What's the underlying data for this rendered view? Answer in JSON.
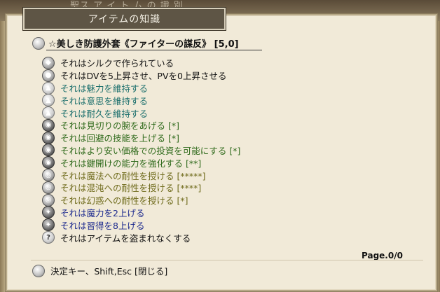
{
  "window": {
    "behind_title": "聖ス ア イ ト ム の 識 別",
    "title": "アイテムの知識"
  },
  "item": {
    "name": "☆美しき防護外套《ファイターの謀反》 [5,0]"
  },
  "properties": [
    {
      "text": "それはシルクで作られている",
      "color": "black",
      "icon": "gray-diamond-icon"
    },
    {
      "text": "それはDVを5上昇させ、PVを0上昇させる",
      "color": "black",
      "icon": "gray-shield-icon"
    },
    {
      "text": "それは魅力を維持する",
      "color": "teal",
      "icon": "light-body-icon"
    },
    {
      "text": "それは意思を維持する",
      "color": "teal",
      "icon": "light-body-icon"
    },
    {
      "text": "それは耐久を維持する",
      "color": "teal",
      "icon": "light-body-icon"
    },
    {
      "text": "それは見切りの腕をあげる [*]",
      "color": "green",
      "icon": "dark-skill-icon"
    },
    {
      "text": "それは回避の技能を上げる [*]",
      "color": "green",
      "icon": "dark-skill-icon"
    },
    {
      "text": "それはより安い価格での投資を可能にする [*]",
      "color": "green",
      "icon": "dark-skill-icon"
    },
    {
      "text": "それは鍵開けの能力を強化する [**]",
      "color": "green",
      "icon": "dark-skill-icon"
    },
    {
      "text": "それは魔法への耐性を授ける [*****]",
      "color": "olive",
      "icon": "gray-resist-icon"
    },
    {
      "text": "それは混沌への耐性を授ける [****]",
      "color": "olive",
      "icon": "gray-resist-icon"
    },
    {
      "text": "それは幻惑への耐性を授ける [*]",
      "color": "olive",
      "icon": "gray-resist-icon"
    },
    {
      "text": "それは魔力を2上げる",
      "color": "blue",
      "icon": "dark-attribute-icon"
    },
    {
      "text": "それは習得を8上げる",
      "color": "blue",
      "icon": "dark-attribute-icon"
    },
    {
      "text": "それはアイテムを盗まれなくする",
      "color": "black",
      "icon": "dark-special-icon"
    }
  ],
  "page_indicator": "Page.0/0",
  "footer": {
    "hint": "決定キー、Shift,Esc [閉じる]"
  }
}
